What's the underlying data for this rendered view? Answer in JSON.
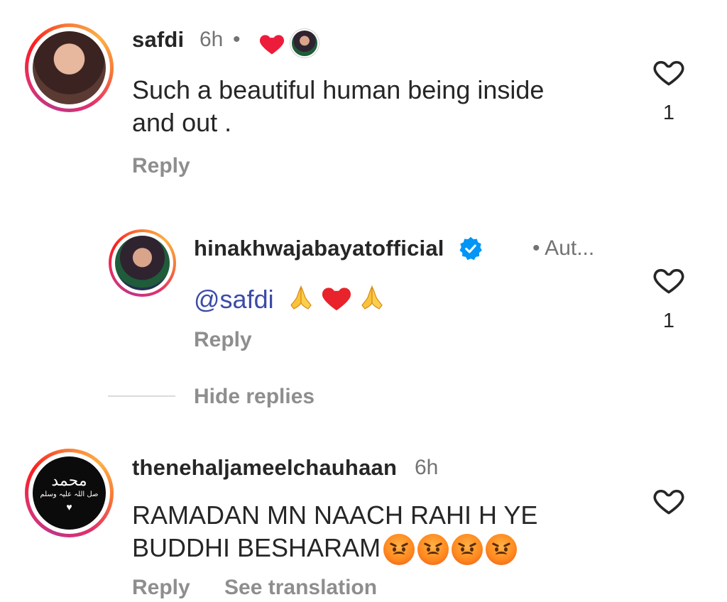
{
  "comments": [
    {
      "username": "safdi",
      "time": "6h",
      "dot": "•",
      "text_line1": "Such a beautiful human being inside",
      "text_line2": "and out .",
      "reply_label": "Reply",
      "likes": "1",
      "heart_icon": "heart-outline-icon",
      "liked_by_author_icon": "red-heart-icon"
    },
    {
      "username": "hinakhwajabayatofficial",
      "meta": "• Aut...",
      "mention": "@safdi",
      "reply_label": "Reply",
      "likes": "1",
      "verified_color": "#0095f6"
    },
    {
      "username": "thenehaljameelchauhaan",
      "time": "6h",
      "text_line1": "RAMADAN MN NAACH RAHI H YE",
      "text_line2": "BUDDHI BESHARAM",
      "reply_label": "Reply",
      "see_translation": "See translation"
    }
  ],
  "hide_replies_label": "Hide replies",
  "avatar_neh_calligraphy": "محمد",
  "avatar_neh_sub": "صل اللہ علیہ وسلم",
  "colors": {
    "text": "#262626",
    "muted": "#737373",
    "reply": "#8e8e8e",
    "mention": "#3b4ba8",
    "heart": "#ed1c3a"
  }
}
